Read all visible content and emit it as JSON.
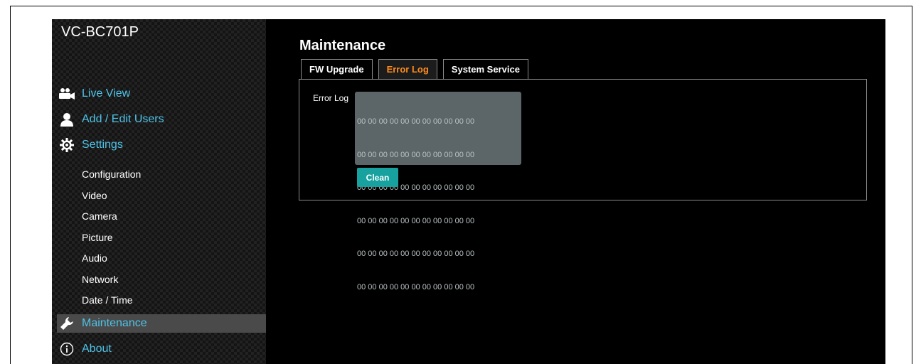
{
  "sidebar": {
    "model": "VC-BC701P",
    "main_items": [
      {
        "label": "Live View",
        "icon": "camera-people-icon"
      },
      {
        "label": "Add / Edit Users",
        "icon": "user-icon"
      },
      {
        "label": "Settings",
        "icon": "gear-icon"
      }
    ],
    "sub_items": [
      {
        "label": "Configuration"
      },
      {
        "label": "Video"
      },
      {
        "label": "Camera"
      },
      {
        "label": "Picture"
      },
      {
        "label": "Audio"
      },
      {
        "label": "Network"
      },
      {
        "label": "Date / Time"
      }
    ],
    "maintenance": {
      "label": "Maintenance",
      "icon": "wrench-icon",
      "active": true
    },
    "about": {
      "label": "About",
      "icon": "info-icon"
    }
  },
  "main": {
    "title": "Maintenance",
    "tabs": [
      {
        "label": "FW Upgrade",
        "active": false
      },
      {
        "label": "Error Log",
        "active": true
      },
      {
        "label": "System Service",
        "active": false
      }
    ],
    "error_log": {
      "label": "Error Log",
      "lines": [
        "00 00 00 00 00 00 00 00 00 00 00",
        "00 00 00 00 00 00 00 00 00 00 00",
        "00 00 00 00 00 00 00 00 00 00 00",
        "00 00 00 00 00 00 00 00 00 00 00",
        "00 00 00 00 00 00 00 00 00 00 00",
        "00 00 00 00 00 00 00 00 00 00 00"
      ],
      "clean_label": "Clean"
    }
  },
  "colors": {
    "accent_blue": "#4fc3e8",
    "active_tab": "#ff8c1a",
    "button_teal": "#17a2a0"
  }
}
